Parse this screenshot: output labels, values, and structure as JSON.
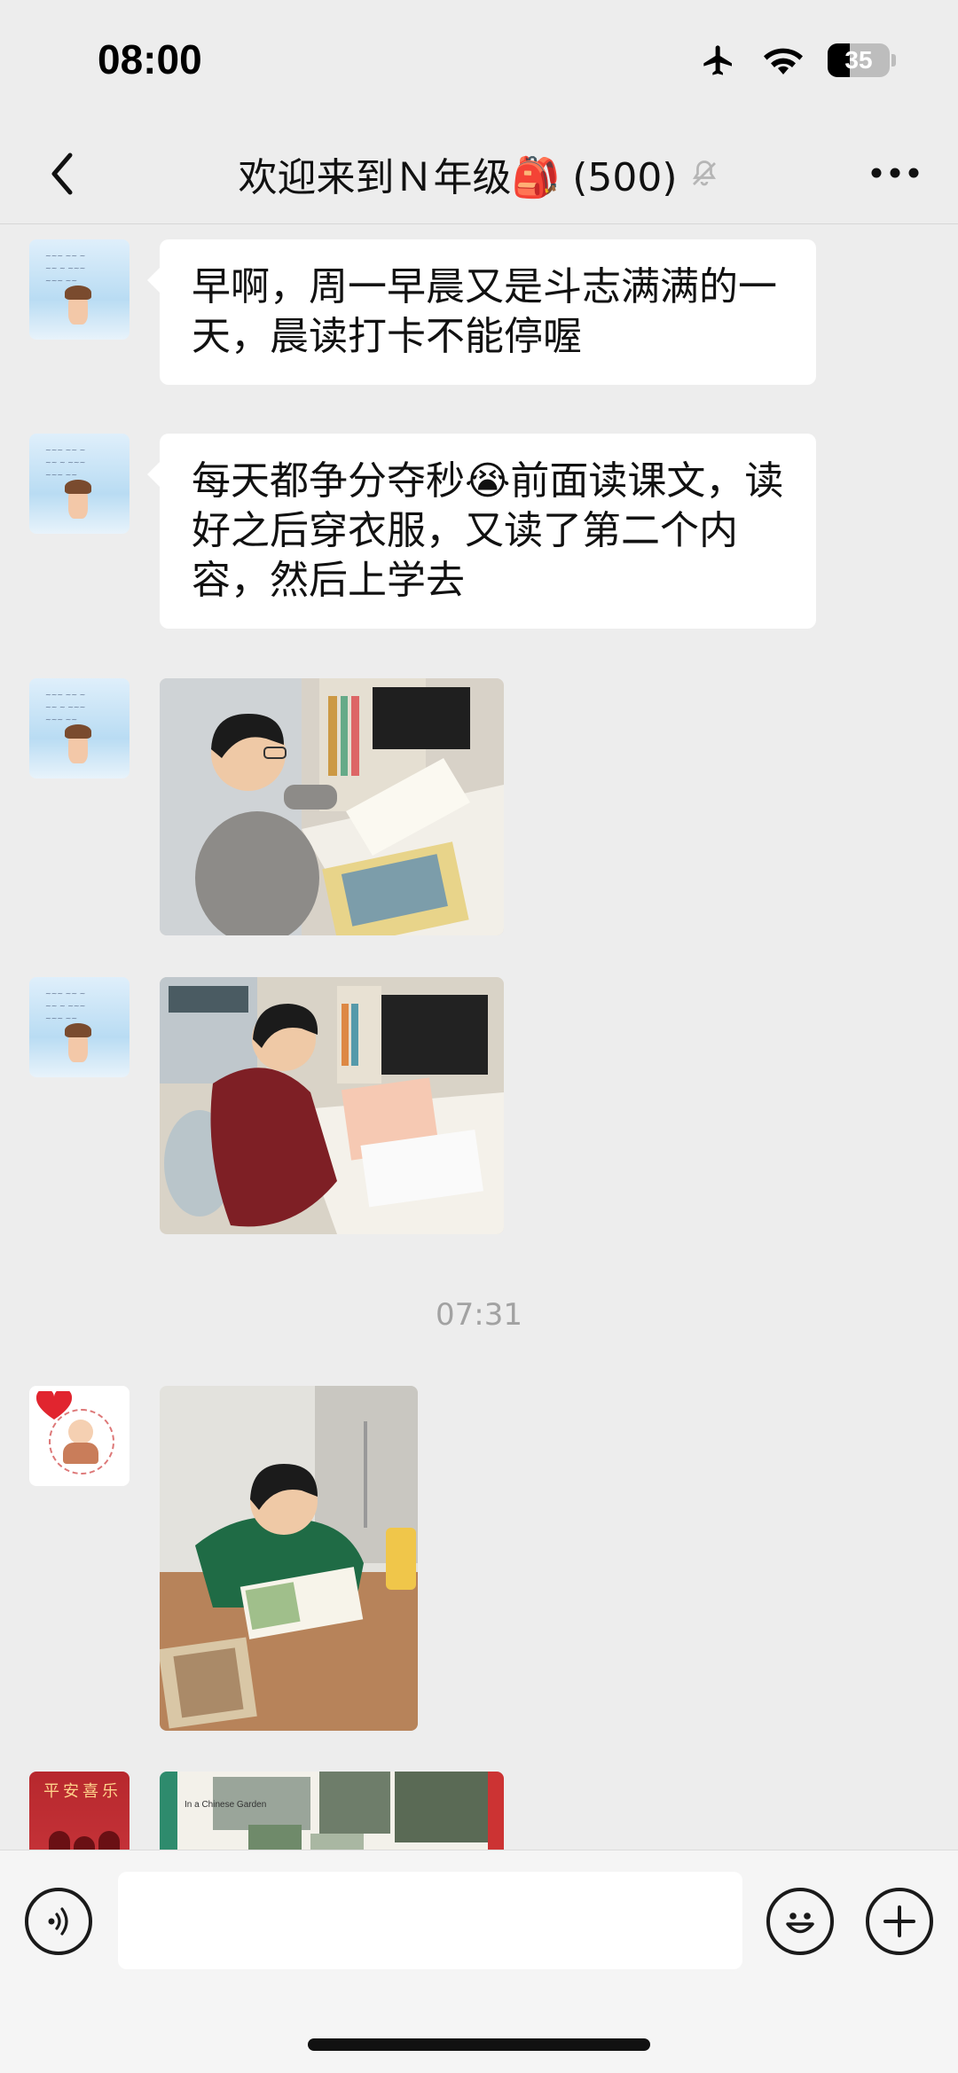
{
  "status_bar": {
    "time": "08:00",
    "battery": "35",
    "icons": [
      "airplane-icon",
      "wifi-icon",
      "battery-icon"
    ]
  },
  "nav": {
    "back_icon": "chevron-left-icon",
    "title": "欢迎来到Ｎ年级🎒 (500)",
    "mute_icon": "bell-muted-icon",
    "more_icon": "more-dots-icon"
  },
  "messages": [
    {
      "type": "text",
      "avatar": "sky-avatar",
      "text": "早啊，周一早晨又是斗志满满的一天，晨读打卡不能停喔"
    },
    {
      "type": "text",
      "avatar": "sky-avatar",
      "text": "每天都争分夺秒😭前面读课文，读好之后穿衣服，又读了第二个内容，然后上学去"
    },
    {
      "type": "image",
      "avatar": "sky-avatar",
      "image": "boy-grey-sweater-reading-photo"
    },
    {
      "type": "image",
      "avatar": "sky-avatar",
      "image": "boy-red-jacket-reading-photo"
    },
    {
      "type": "time",
      "text": "07:31"
    },
    {
      "type": "image",
      "avatar": "heart-avatar",
      "image": "boy-green-jacket-reading-photo"
    },
    {
      "type": "image",
      "avatar": "red-avatar",
      "image": "textbook-page-photo",
      "avatar_text": "平安喜乐",
      "image_text": "In a Chinese Garden"
    }
  ],
  "input_bar": {
    "voice_icon": "voice-icon",
    "emoji_icon": "emoji-icon",
    "plus_icon": "plus-icon",
    "placeholder": ""
  }
}
